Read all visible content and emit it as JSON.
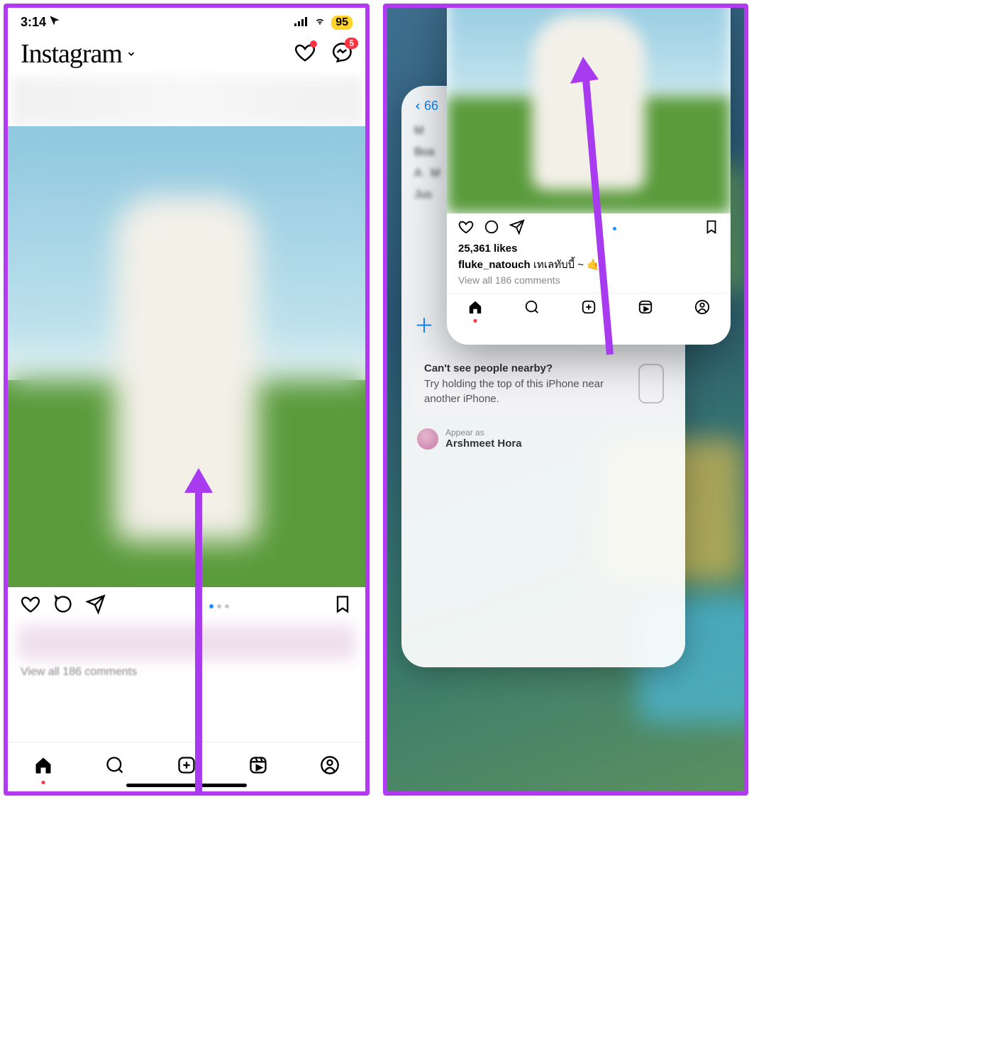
{
  "status": {
    "time": "3:14",
    "battery": "95"
  },
  "header": {
    "logo": "Instagram",
    "dm_badge": "5"
  },
  "post": {
    "view_all": "View all 186 comments"
  },
  "switcher": {
    "back_nav": "66",
    "rows": {
      "m": "M",
      "boa": "Boa",
      "a": "A",
      "m2": "M",
      "jus": "Jus"
    },
    "namedrop_title": "Can't see people nearby?",
    "namedrop_body": "Try holding the top of this iPhone near another iPhone.",
    "appear_label": "Appear as",
    "appear_name": "Arshmeet Hora"
  },
  "front_card": {
    "likes": "25,361 likes",
    "user": "fluke_natouch",
    "caption": "เทเลทับบี้ ~ 🤙",
    "view_all": "View all 186 comments"
  }
}
